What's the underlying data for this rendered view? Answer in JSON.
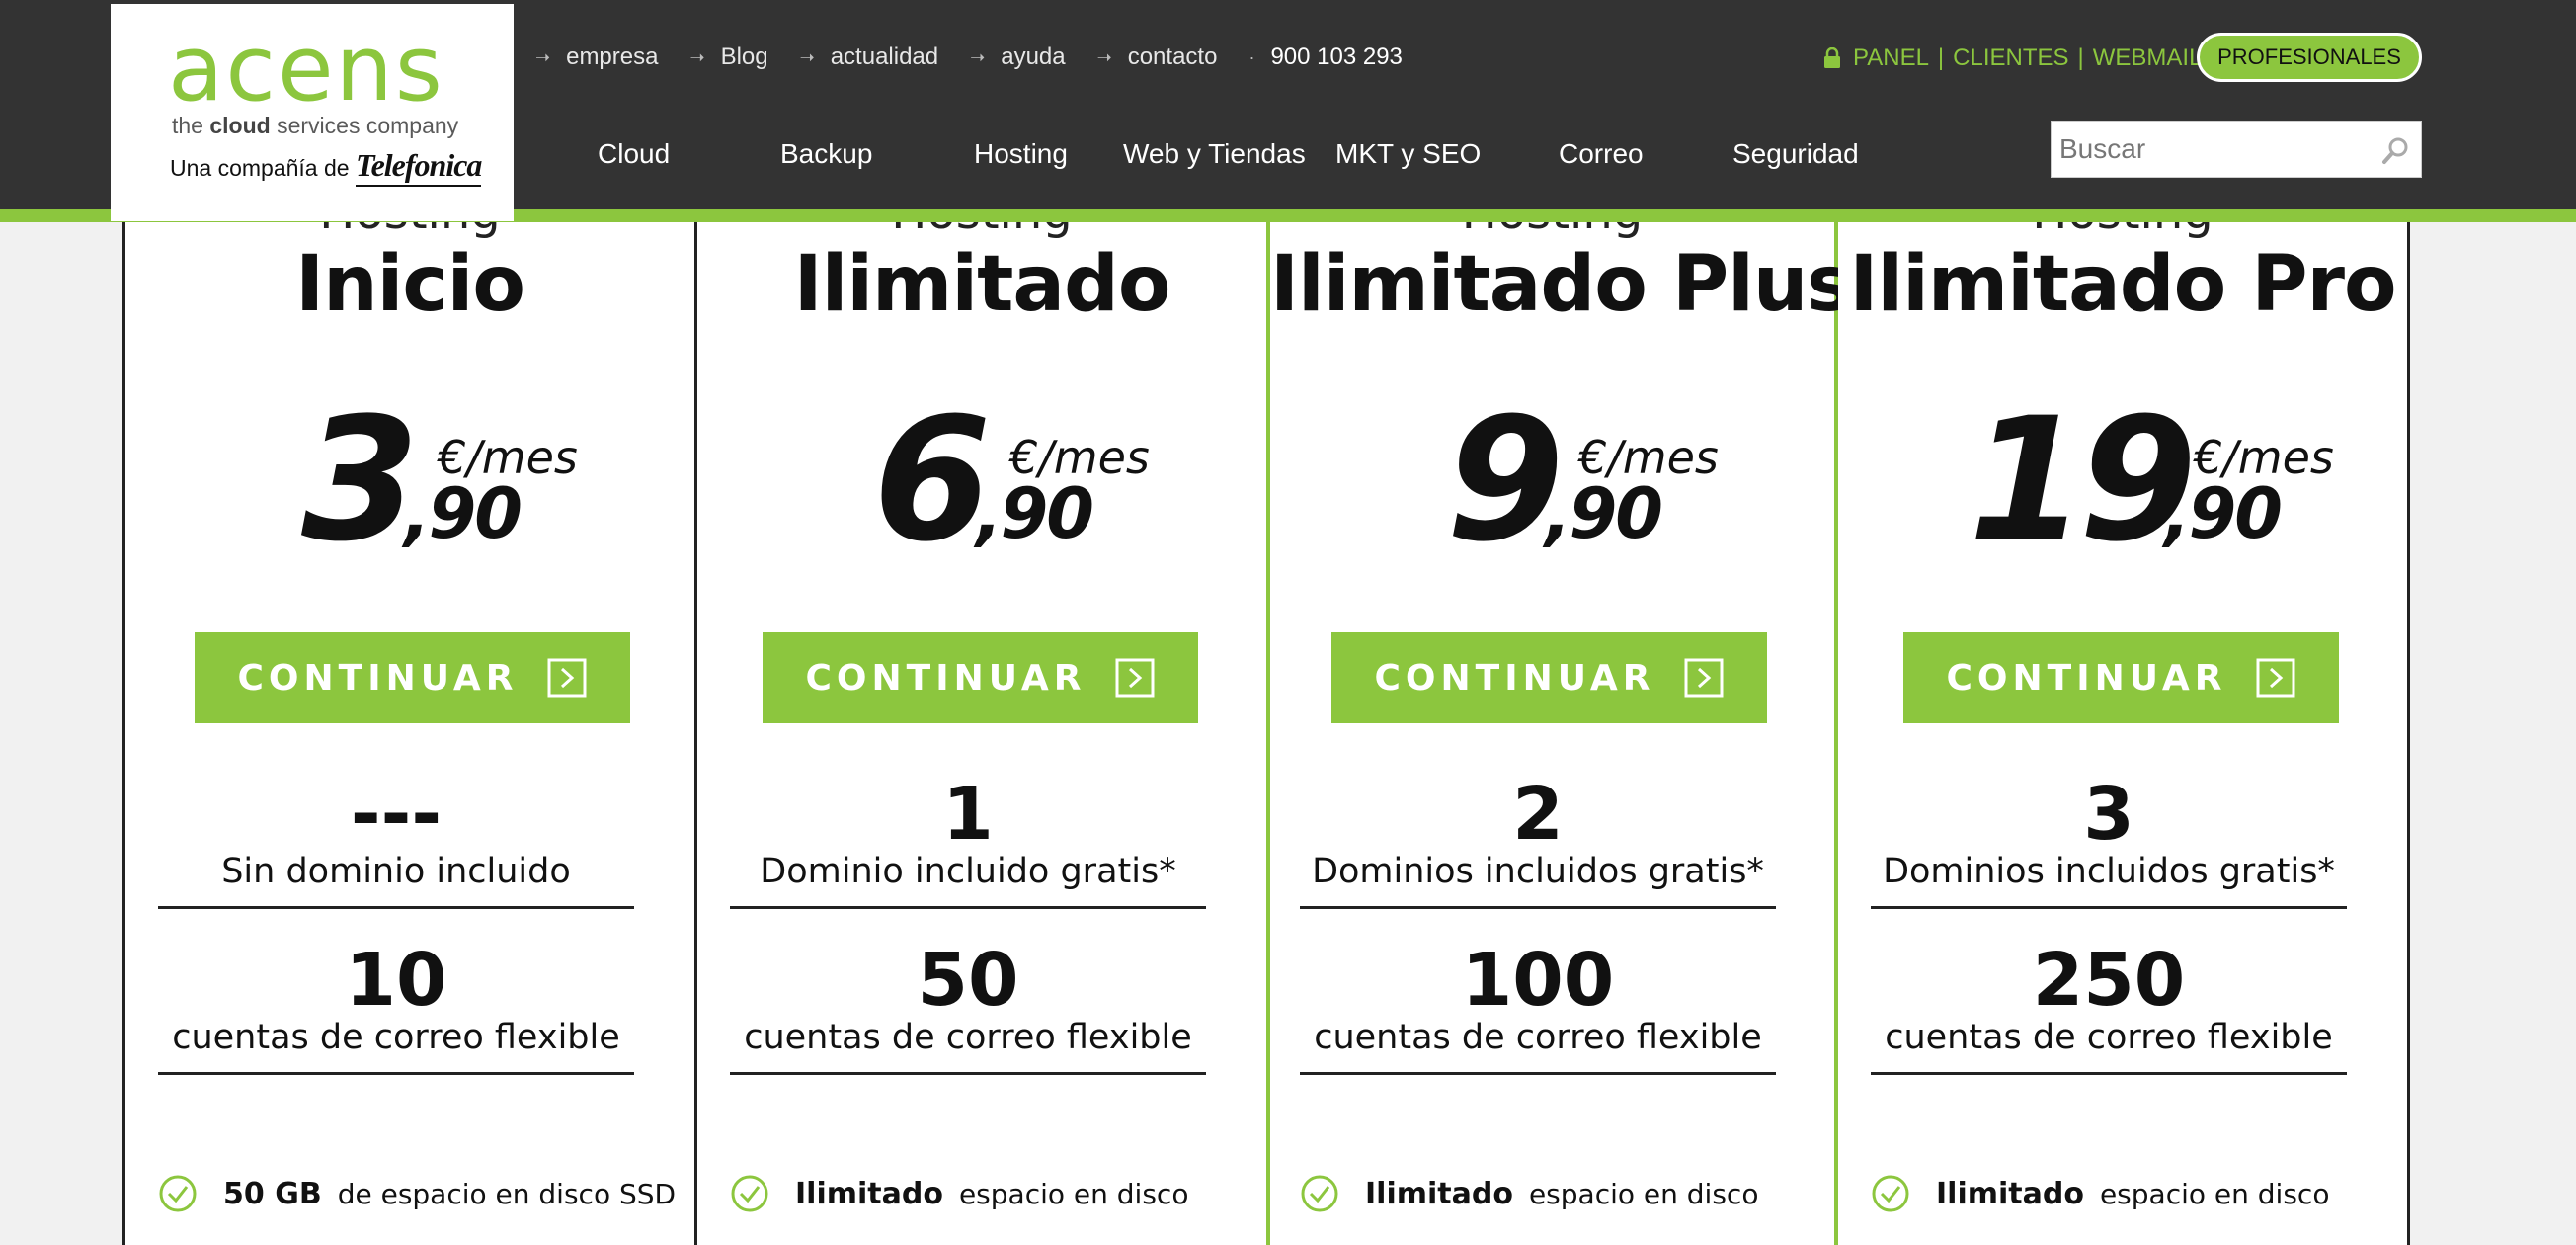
{
  "brand": {
    "logo_word": "acens",
    "tagline_pre": "the",
    "tagline_bold": "cloud",
    "tagline_post": "services company",
    "company_prefix": "Una compañía de",
    "company_name": "Telefonica",
    "accent": "#8cc63e",
    "header_bg": "#333333"
  },
  "top_links": [
    "empresa",
    "Blog",
    "actualidad",
    "ayuda",
    "contacto"
  ],
  "phone": "900 103 293",
  "user_links": {
    "icon": "lock-icon",
    "panel": "PANEL",
    "clientes": "CLIENTES",
    "webmail": "WEBMAIL",
    "separator": "|",
    "pro_button": "PROFESIONALES"
  },
  "nav": [
    "Cloud",
    "Backup",
    "Hosting",
    "Web y Tiendas",
    "MKT y SEO",
    "Correo",
    "Seguridad"
  ],
  "search": {
    "placeholder": "Buscar",
    "icon": "search-icon"
  },
  "plans": [
    {
      "category": "Hosting",
      "name": "Inicio",
      "price_int": "3",
      "price_dec": ",90",
      "price_unit": "€/mes",
      "cta": "CONTINUAR",
      "domains_value": "---",
      "domains_label": "Sin dominio incluido",
      "mail_value": "10",
      "mail_label": "cuentas de correo flexible",
      "disk_strong": "50 GB",
      "disk_text": "de espacio en disco SSD",
      "featured": false
    },
    {
      "category": "Hosting",
      "name": "Ilimitado",
      "price_int": "6",
      "price_dec": ",90",
      "price_unit": "€/mes",
      "cta": "CONTINUAR",
      "domains_value": "1",
      "domains_label": "Dominio incluido gratis*",
      "mail_value": "50",
      "mail_label": "cuentas de correo flexible",
      "disk_strong": "Ilimitado",
      "disk_text": "espacio en disco",
      "featured": false
    },
    {
      "category": "Hosting",
      "name": "Ilimitado Plus",
      "price_int": "9",
      "price_dec": ",90",
      "price_unit": "€/mes",
      "cta": "CONTINUAR",
      "domains_value": "2",
      "domains_label": "Dominios incluidos gratis*",
      "mail_value": "100",
      "mail_label": "cuentas de correo flexible",
      "disk_strong": "Ilimitado",
      "disk_text": "espacio en disco",
      "featured": true
    },
    {
      "category": "Hosting",
      "name": "Ilimitado Pro",
      "price_int": "19",
      "price_dec": ",90",
      "price_unit": "€/mes",
      "cta": "CONTINUAR",
      "domains_value": "3",
      "domains_label": "Dominios incluidos gratis*",
      "mail_value": "250",
      "mail_label": "cuentas de correo flexible",
      "disk_strong": "Ilimitado",
      "disk_text": "espacio en disco",
      "featured": false
    }
  ]
}
